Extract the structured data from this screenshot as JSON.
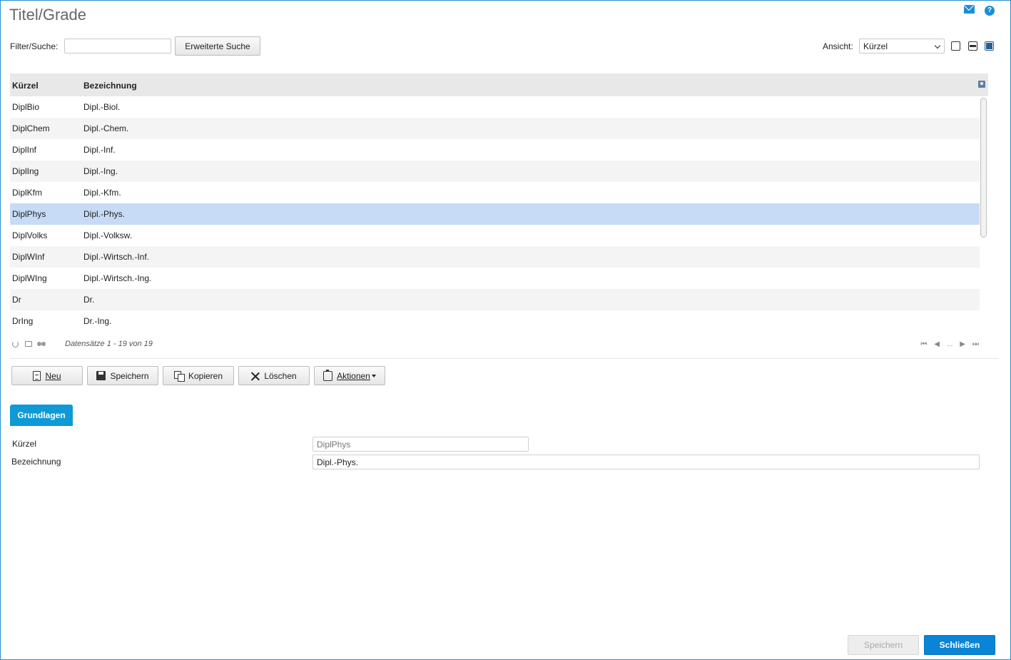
{
  "header": {
    "title": "Titel/Grade",
    "icons": [
      "mail-icon",
      "help-icon"
    ]
  },
  "filter": {
    "label": "Filter/Suche:",
    "value": "",
    "advanced_search_label": "Erweiterte Suche"
  },
  "view": {
    "label": "Ansicht:",
    "selected": "Kürzel"
  },
  "grid": {
    "columns": [
      "Kürzel",
      "Bezeichnung"
    ],
    "rows": [
      {
        "kuerzel": "DiplBio",
        "bezeichnung": "Dipl.-Biol."
      },
      {
        "kuerzel": "DiplChem",
        "bezeichnung": "Dipl.-Chem."
      },
      {
        "kuerzel": "DiplInf",
        "bezeichnung": "Dipl.-Inf."
      },
      {
        "kuerzel": "DiplIng",
        "bezeichnung": "Dipl.-Ing."
      },
      {
        "kuerzel": "DiplKfm",
        "bezeichnung": "Dipl.-Kfm."
      },
      {
        "kuerzel": "DiplPhys",
        "bezeichnung": "Dipl.-Phys."
      },
      {
        "kuerzel": "DiplVolks",
        "bezeichnung": "Dipl.-Volksw."
      },
      {
        "kuerzel": "DiplWInf",
        "bezeichnung": "Dipl.-Wirtsch.-Inf."
      },
      {
        "kuerzel": "DiplWIng",
        "bezeichnung": "Dipl.-Wirtsch.-Ing."
      },
      {
        "kuerzel": "Dr",
        "bezeichnung": "Dr."
      },
      {
        "kuerzel": "DrIng",
        "bezeichnung": "Dr.-Ing."
      }
    ],
    "selected_index": 5,
    "records_text": "Datensätze 1 - 19 von 19",
    "pager": [
      "⏮",
      "◀",
      "...",
      "▶",
      "⏭"
    ]
  },
  "toolbar": {
    "neu": "Neu",
    "speichern": "Speichern",
    "kopieren": "Kopieren",
    "loeschen": "Löschen",
    "aktionen": "Aktionen"
  },
  "tabs": [
    {
      "label": "Grundlagen",
      "active": true
    }
  ],
  "form": {
    "kuerzel_label": "Kürzel",
    "kuerzel_value": "DiplPhys",
    "bezeichnung_label": "Bezeichnung",
    "bezeichnung_value": "Dipl.-Phys."
  },
  "footer": {
    "save_label": "Speichern",
    "close_label": "Schließen"
  },
  "colors": {
    "accent": "#0d9ad6",
    "selected_row": "#c7dbf6",
    "close_button": "#0a84d6"
  }
}
